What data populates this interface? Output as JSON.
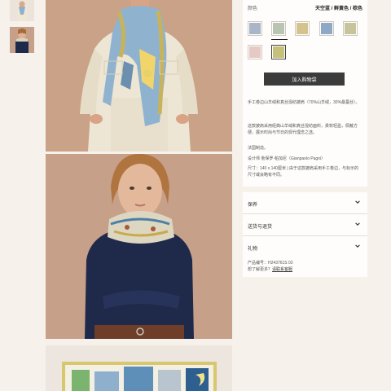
{
  "product": {
    "color_label": "颜色",
    "color_value": "天空蓝 / 鲜黄色 / 棕色",
    "add_to_cart": "加入购物袋",
    "desc_lines": [
      "手工卷边山羊绒和真丝混纺披肩（70%山羊绒，30%桑蚕丝）。",
      "这款披肩采用经典山羊绒和真丝混纺面料，柔软轻盈，佩戴方便，展示时尚与节日的现代理念之选。",
      "法国制造。",
      "设计师 詹保罗·帕加尼（Gianpaolo Pagni）",
      "尺寸：140 x 140厘米 | 由于这款披肩采用手工卷边，与标示的尺寸或会略有不同。"
    ],
    "swatches": [
      "#a8b6c8",
      "#b9c4b2",
      "#d2c48c",
      "#8ea9c6",
      "#c7c39b",
      "#e4c9c4",
      "#c5c07a"
    ]
  },
  "accordion": [
    {
      "label": "保养"
    },
    {
      "label": "送货与退货"
    },
    {
      "label": "礼物"
    }
  ],
  "meta": {
    "product_code_label": "产品编号：",
    "product_code": "H243761S 02",
    "more_prefix": "想了解更多？",
    "more_link": "请联系客服"
  },
  "colors": {
    "page_bg": "#f6f1eb",
    "panel_bg": "#fffdfb",
    "button_bg": "#3b3b3b"
  }
}
